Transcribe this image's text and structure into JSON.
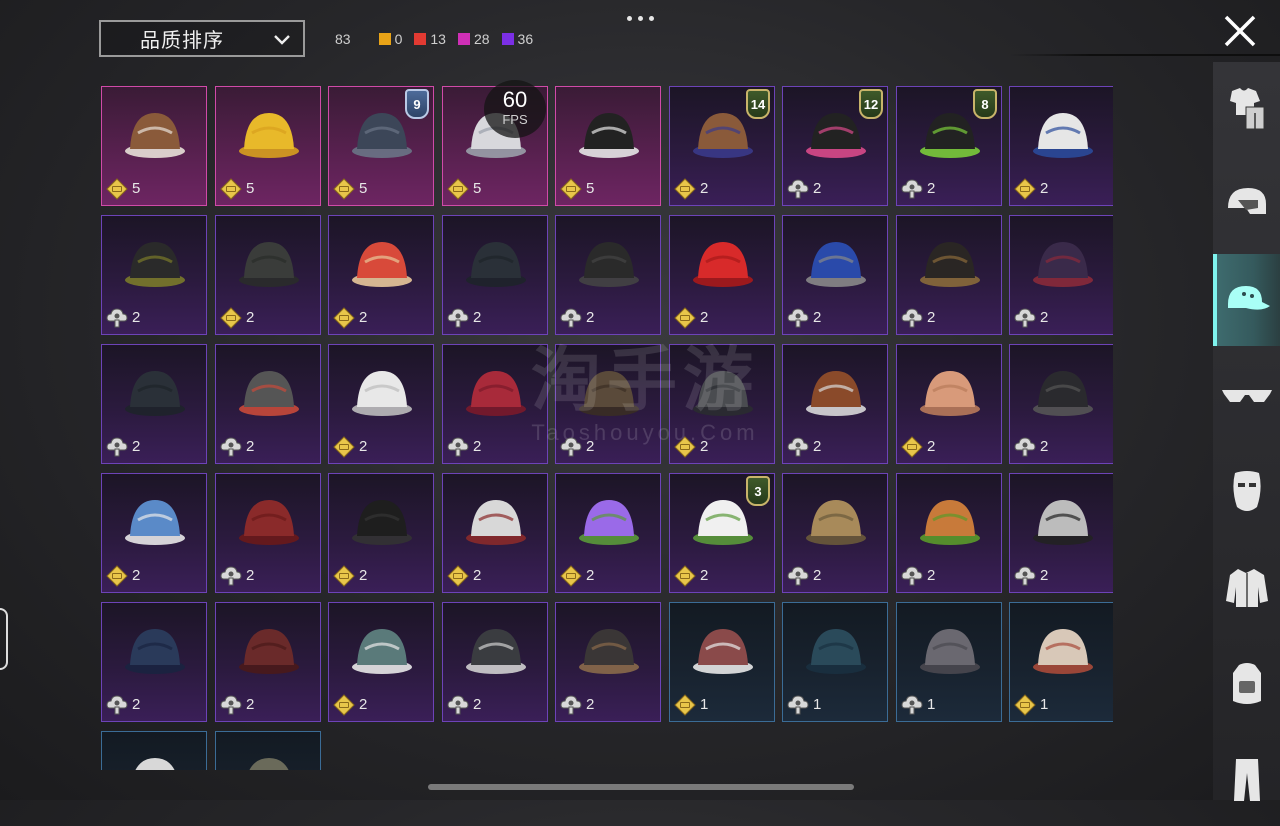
{
  "header": {
    "sort_label": "品质排序",
    "total_count": "83",
    "counts": [
      {
        "color": "#e8a317",
        "value": "0"
      },
      {
        "color": "#e23a32",
        "value": "13"
      },
      {
        "color": "#cf2fb6",
        "value": "28"
      },
      {
        "color": "#7b2fe6",
        "value": "36"
      }
    ]
  },
  "fps": {
    "value": "60",
    "unit": "FPS"
  },
  "watermark": {
    "cn": "淘手游",
    "en": "Taoshouyou.Com"
  },
  "sidebar": {
    "active_index": 2,
    "items": [
      {
        "icon": "outfit-icon"
      },
      {
        "icon": "helmet-icon"
      },
      {
        "icon": "cap-icon"
      },
      {
        "icon": "glasses-icon"
      },
      {
        "icon": "mask-icon"
      },
      {
        "icon": "jacket-icon"
      },
      {
        "icon": "backpack-icon"
      },
      {
        "icon": "pants-icon"
      }
    ]
  },
  "items": [
    {
      "rarity": "pink",
      "cur": "gold",
      "qty": "5",
      "art": "horse-mask"
    },
    {
      "rarity": "pink",
      "cur": "gold",
      "qty": "5",
      "art": "duck-hat"
    },
    {
      "rarity": "pink",
      "cur": "gold",
      "qty": "5",
      "art": "straw-hat",
      "badge": "9",
      "badge_style": "blue"
    },
    {
      "rarity": "pink",
      "cur": "gold",
      "qty": "5",
      "art": "white-hat"
    },
    {
      "rarity": "pink",
      "cur": "gold",
      "qty": "5",
      "art": "skull-mask"
    },
    {
      "rarity": "purple",
      "cur": "gold",
      "qty": "2",
      "art": "wig",
      "badge": "14"
    },
    {
      "rarity": "purple",
      "cur": "cloud",
      "qty": "2",
      "art": "bunny-helmet",
      "badge": "12"
    },
    {
      "rarity": "purple",
      "cur": "cloud",
      "qty": "2",
      "art": "green-mask",
      "badge": "8"
    },
    {
      "rarity": "purple",
      "cur": "gold",
      "qty": "2",
      "art": "blue-cap"
    },
    {
      "rarity": "purple",
      "cur": "cloud",
      "qty": "2",
      "art": "gas-helmet"
    },
    {
      "rarity": "purple",
      "cur": "gold",
      "qty": "2",
      "art": "gray-cap"
    },
    {
      "rarity": "purple",
      "cur": "gold",
      "qty": "2",
      "art": "horns"
    },
    {
      "rarity": "purple",
      "cur": "cloud",
      "qty": "2",
      "art": "beanie"
    },
    {
      "rarity": "purple",
      "cur": "cloud",
      "qty": "2",
      "art": "witch-hat"
    },
    {
      "rarity": "purple",
      "cur": "gold",
      "qty": "2",
      "art": "red-mohawk"
    },
    {
      "rarity": "purple",
      "cur": "cloud",
      "qty": "2",
      "art": "cricket-helmet"
    },
    {
      "rarity": "purple",
      "cur": "cloud",
      "qty": "2",
      "art": "steampunk-hat"
    },
    {
      "rarity": "purple",
      "cur": "cloud",
      "qty": "2",
      "art": "tricorn-hat"
    },
    {
      "rarity": "purple",
      "cur": "cloud",
      "qty": "2",
      "art": "dark-cap"
    },
    {
      "rarity": "purple",
      "cur": "cloud",
      "qty": "2",
      "art": "goggle-helmet"
    },
    {
      "rarity": "purple",
      "cur": "gold",
      "qty": "2",
      "art": "turban"
    },
    {
      "rarity": "purple",
      "cur": "cloud",
      "qty": "2",
      "art": "red-beret"
    },
    {
      "rarity": "purple",
      "cur": "cloud",
      "qty": "2",
      "art": "aviator-cap"
    },
    {
      "rarity": "purple",
      "cur": "gold",
      "qty": "2",
      "art": "baseball-cap"
    },
    {
      "rarity": "purple",
      "cur": "cloud",
      "qty": "2",
      "art": "football-helmet"
    },
    {
      "rarity": "purple",
      "cur": "gold",
      "qty": "2",
      "art": "conical-hat"
    },
    {
      "rarity": "purple",
      "cur": "cloud",
      "qty": "2",
      "art": "wrestler-mask"
    },
    {
      "rarity": "purple",
      "cur": "gold",
      "qty": "2",
      "art": "shark-hat"
    },
    {
      "rarity": "purple",
      "cur": "cloud",
      "qty": "2",
      "art": "red-beret-2"
    },
    {
      "rarity": "purple",
      "cur": "gold",
      "qty": "2",
      "art": "bowler-hat"
    },
    {
      "rarity": "purple",
      "cur": "gold",
      "qty": "2",
      "art": "white-shark-hat"
    },
    {
      "rarity": "purple",
      "cur": "gold",
      "qty": "2",
      "art": "purple-flower-crown"
    },
    {
      "rarity": "purple",
      "cur": "gold",
      "qty": "2",
      "art": "white-flower-crown",
      "badge": "3"
    },
    {
      "rarity": "purple",
      "cur": "cloud",
      "qty": "2",
      "art": "knit-hat"
    },
    {
      "rarity": "purple",
      "cur": "cloud",
      "qty": "2",
      "art": "burger-hat"
    },
    {
      "rarity": "purple",
      "cur": "cloud",
      "qty": "2",
      "art": "head-mirror"
    },
    {
      "rarity": "purple",
      "cur": "cloud",
      "qty": "2",
      "art": "sailor-cap"
    },
    {
      "rarity": "purple",
      "cur": "cloud",
      "qty": "2",
      "art": "fedora"
    },
    {
      "rarity": "purple",
      "cur": "gold",
      "qty": "2",
      "art": "bandana"
    },
    {
      "rarity": "purple",
      "cur": "cloud",
      "qty": "2",
      "art": "bucket-hat"
    },
    {
      "rarity": "purple",
      "cur": "cloud",
      "qty": "2",
      "art": "pilot-cap"
    },
    {
      "rarity": "blue",
      "cur": "gold",
      "qty": "1",
      "art": "cloth-helmet"
    },
    {
      "rarity": "blue",
      "cur": "cloud",
      "qty": "1",
      "art": "blue-beret"
    },
    {
      "rarity": "blue",
      "cur": "cloud",
      "qty": "1",
      "art": "flat-cap"
    },
    {
      "rarity": "blue",
      "cur": "gold",
      "qty": "1",
      "art": "tan-cap"
    },
    {
      "rarity": "blue",
      "cur": "gold",
      "qty": "",
      "art": "blue-cap-2"
    },
    {
      "rarity": "blue",
      "cur": "gold",
      "qty": "",
      "art": "camo-cap"
    }
  ]
}
